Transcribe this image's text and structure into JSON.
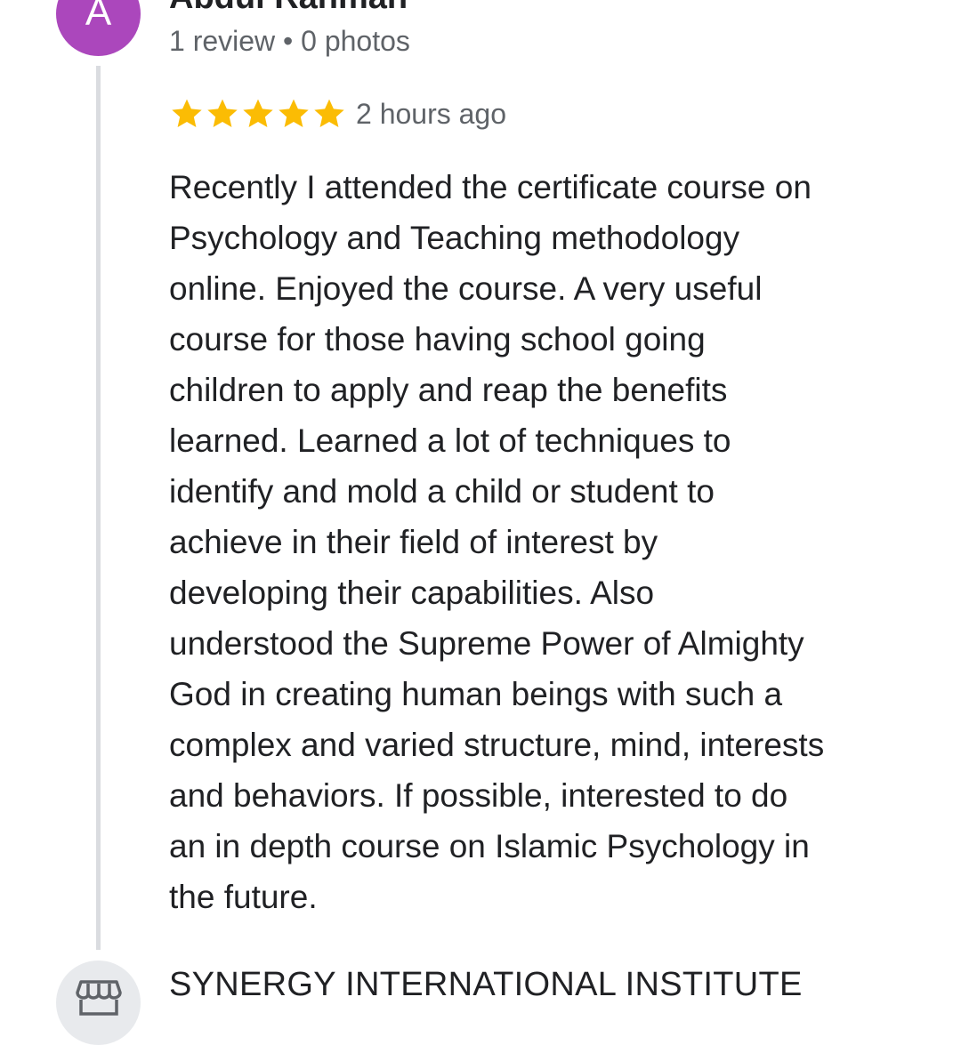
{
  "review": {
    "avatar_letter": "A",
    "avatar_color": "#ab47bc",
    "reviewer_name": "Abdul Rahman",
    "reviewer_meta": "1 review • 0 photos",
    "rating": 5,
    "rating_max": 5,
    "star_color": "#fbbc04",
    "time": "2 hours ago",
    "text_lines": [
      "Recently I attended the certificate course on",
      "Psychology and Teaching methodology",
      "online. Enjoyed the course. A very useful",
      "course for those having school going",
      "children to apply and reap the benefits",
      "learned. Learned a lot of techniques to",
      "identify and mold a child or student to",
      "achieve in their field of interest by",
      "developing their capabilities. Also",
      "understood the Supreme Power of Almighty",
      "God in creating human beings with such a",
      "complex and varied structure, mind, interests",
      "and behaviors. If possible, interested to do",
      "an in depth course on Islamic Psychology in",
      "the future."
    ]
  },
  "owner_response": {
    "icon": "storefront-icon",
    "name": "SYNERGY INTERNATIONAL INSTITUTE"
  }
}
